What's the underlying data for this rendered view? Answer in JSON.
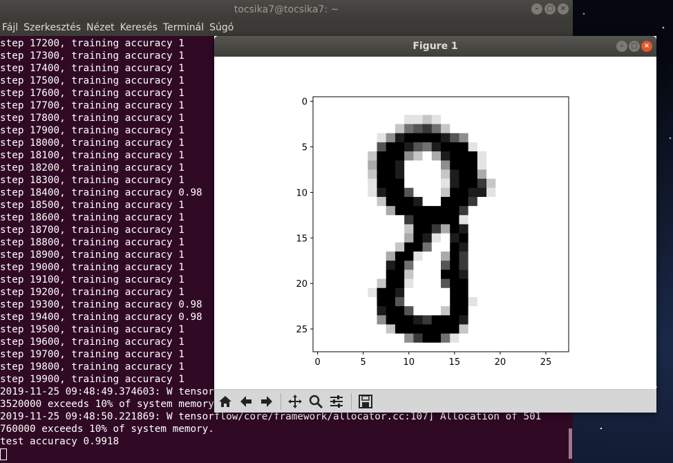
{
  "terminal": {
    "title": "tocsika7@tocsika7: ~",
    "menu": [
      "Fájl",
      "Szerkesztés",
      "Nézet",
      "Keresés",
      "Terminál",
      "Súgó"
    ],
    "lines": [
      "step 17200, training accuracy 1",
      "step 17300, training accuracy 1",
      "step 17400, training accuracy 1",
      "step 17500, training accuracy 1",
      "step 17600, training accuracy 1",
      "step 17700, training accuracy 1",
      "step 17800, training accuracy 1",
      "step 17900, training accuracy 1",
      "step 18000, training accuracy 1",
      "step 18100, training accuracy 1",
      "step 18200, training accuracy 1",
      "step 18300, training accuracy 1",
      "step 18400, training accuracy 0.98",
      "step 18500, training accuracy 1",
      "step 18600, training accuracy 1",
      "step 18700, training accuracy 1",
      "step 18800, training accuracy 1",
      "step 18900, training accuracy 1",
      "step 19000, training accuracy 1",
      "step 19100, training accuracy 1",
      "step 19200, training accuracy 1",
      "step 19300, training accuracy 0.98",
      "step 19400, training accuracy 0.98",
      "step 19500, training accuracy 1",
      "step 19600, training accuracy 1",
      "step 19700, training accuracy 1",
      "step 19800, training accuracy 1",
      "step 19900, training accuracy 1",
      "2019-11-25 09:48:49.374603: W tensorflow/core/framework/allocator.cc:107] Allocation of 501",
      "3520000 exceeds 10% of system memory.",
      "2019-11-25 09:48:50.221869: W tensorflow/core/framework/allocator.cc:107] Allocation of 501",
      "760000 exceeds 10% of system memory.",
      "test accuracy 0.9918"
    ],
    "colors": {
      "background": "#300a24",
      "text": "#ffffff"
    }
  },
  "figure": {
    "title": "Figure 1",
    "toolbar": [
      {
        "name": "home-icon",
        "label": "Home"
      },
      {
        "name": "back-arrow-icon",
        "label": "Back"
      },
      {
        "name": "forward-arrow-icon",
        "label": "Forward"
      },
      {
        "name": "pan-icon",
        "label": "Pan"
      },
      {
        "name": "zoom-icon",
        "label": "Zoom"
      },
      {
        "name": "configure-subplots-icon",
        "label": "Subplots"
      },
      {
        "name": "save-icon",
        "label": "Save"
      }
    ]
  },
  "chart_data": {
    "type": "heatmap",
    "colormap": "gray_r",
    "xlim": [
      -0.5,
      27.5
    ],
    "ylim": [
      27.5,
      -0.5
    ],
    "xticks": [
      0,
      5,
      10,
      15,
      20,
      25
    ],
    "yticks": [
      0,
      5,
      10,
      15,
      20,
      25
    ],
    "rows": [
      "0000000000000000000000000000",
      "0000000000000000000000000000",
      "0000000000112100000000000000",
      "0000000002567520000000000000",
      "0000000148999986400000000000",
      "0000000699865899910000000000",
      "0000002999420389991000000000",
      "0000003998000049991000000000",
      "0000002998000028993000000000",
      "0000001999000018997200000000",
      "0000001899600029988100000000",
      "0000000299980099970000000000",
      "0000000039999999700000000000",
      "0000000000799999100000000000",
      "0000000000299739800000000000",
      "0000000000398108900000000000",
      "0000000002995009800000000000",
      "0000000039910039700000000000",
      "0000000089500069700000000000",
      "0000000099200099800000000000",
      "0000000299100069900000000000",
      "0000001998000009900000000000",
      "0000000996000009910000000000",
      "0000000899600029900000000000",
      "0000000499987999800000000000",
      "0000000029999999200000000000",
      "0000000000479951000000000000",
      "0000000000000000000000000000"
    ]
  }
}
